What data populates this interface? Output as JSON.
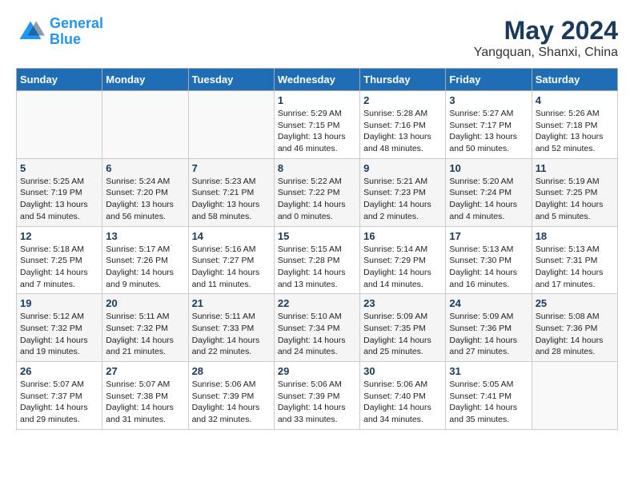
{
  "header": {
    "logo_line1": "General",
    "logo_line2": "Blue",
    "title": "May 2024",
    "subtitle": "Yangquan, Shanxi, China"
  },
  "weekdays": [
    "Sunday",
    "Monday",
    "Tuesday",
    "Wednesday",
    "Thursday",
    "Friday",
    "Saturday"
  ],
  "weeks": [
    [
      {
        "day": "",
        "sunrise": "",
        "sunset": "",
        "daylight": ""
      },
      {
        "day": "",
        "sunrise": "",
        "sunset": "",
        "daylight": ""
      },
      {
        "day": "",
        "sunrise": "",
        "sunset": "",
        "daylight": ""
      },
      {
        "day": "1",
        "sunrise": "Sunrise: 5:29 AM",
        "sunset": "Sunset: 7:15 PM",
        "daylight": "Daylight: 13 hours and 46 minutes."
      },
      {
        "day": "2",
        "sunrise": "Sunrise: 5:28 AM",
        "sunset": "Sunset: 7:16 PM",
        "daylight": "Daylight: 13 hours and 48 minutes."
      },
      {
        "day": "3",
        "sunrise": "Sunrise: 5:27 AM",
        "sunset": "Sunset: 7:17 PM",
        "daylight": "Daylight: 13 hours and 50 minutes."
      },
      {
        "day": "4",
        "sunrise": "Sunrise: 5:26 AM",
        "sunset": "Sunset: 7:18 PM",
        "daylight": "Daylight: 13 hours and 52 minutes."
      }
    ],
    [
      {
        "day": "5",
        "sunrise": "Sunrise: 5:25 AM",
        "sunset": "Sunset: 7:19 PM",
        "daylight": "Daylight: 13 hours and 54 minutes."
      },
      {
        "day": "6",
        "sunrise": "Sunrise: 5:24 AM",
        "sunset": "Sunset: 7:20 PM",
        "daylight": "Daylight: 13 hours and 56 minutes."
      },
      {
        "day": "7",
        "sunrise": "Sunrise: 5:23 AM",
        "sunset": "Sunset: 7:21 PM",
        "daylight": "Daylight: 13 hours and 58 minutes."
      },
      {
        "day": "8",
        "sunrise": "Sunrise: 5:22 AM",
        "sunset": "Sunset: 7:22 PM",
        "daylight": "Daylight: 14 hours and 0 minutes."
      },
      {
        "day": "9",
        "sunrise": "Sunrise: 5:21 AM",
        "sunset": "Sunset: 7:23 PM",
        "daylight": "Daylight: 14 hours and 2 minutes."
      },
      {
        "day": "10",
        "sunrise": "Sunrise: 5:20 AM",
        "sunset": "Sunset: 7:24 PM",
        "daylight": "Daylight: 14 hours and 4 minutes."
      },
      {
        "day": "11",
        "sunrise": "Sunrise: 5:19 AM",
        "sunset": "Sunset: 7:25 PM",
        "daylight": "Daylight: 14 hours and 5 minutes."
      }
    ],
    [
      {
        "day": "12",
        "sunrise": "Sunrise: 5:18 AM",
        "sunset": "Sunset: 7:25 PM",
        "daylight": "Daylight: 14 hours and 7 minutes."
      },
      {
        "day": "13",
        "sunrise": "Sunrise: 5:17 AM",
        "sunset": "Sunset: 7:26 PM",
        "daylight": "Daylight: 14 hours and 9 minutes."
      },
      {
        "day": "14",
        "sunrise": "Sunrise: 5:16 AM",
        "sunset": "Sunset: 7:27 PM",
        "daylight": "Daylight: 14 hours and 11 minutes."
      },
      {
        "day": "15",
        "sunrise": "Sunrise: 5:15 AM",
        "sunset": "Sunset: 7:28 PM",
        "daylight": "Daylight: 14 hours and 13 minutes."
      },
      {
        "day": "16",
        "sunrise": "Sunrise: 5:14 AM",
        "sunset": "Sunset: 7:29 PM",
        "daylight": "Daylight: 14 hours and 14 minutes."
      },
      {
        "day": "17",
        "sunrise": "Sunrise: 5:13 AM",
        "sunset": "Sunset: 7:30 PM",
        "daylight": "Daylight: 14 hours and 16 minutes."
      },
      {
        "day": "18",
        "sunrise": "Sunrise: 5:13 AM",
        "sunset": "Sunset: 7:31 PM",
        "daylight": "Daylight: 14 hours and 17 minutes."
      }
    ],
    [
      {
        "day": "19",
        "sunrise": "Sunrise: 5:12 AM",
        "sunset": "Sunset: 7:32 PM",
        "daylight": "Daylight: 14 hours and 19 minutes."
      },
      {
        "day": "20",
        "sunrise": "Sunrise: 5:11 AM",
        "sunset": "Sunset: 7:32 PM",
        "daylight": "Daylight: 14 hours and 21 minutes."
      },
      {
        "day": "21",
        "sunrise": "Sunrise: 5:11 AM",
        "sunset": "Sunset: 7:33 PM",
        "daylight": "Daylight: 14 hours and 22 minutes."
      },
      {
        "day": "22",
        "sunrise": "Sunrise: 5:10 AM",
        "sunset": "Sunset: 7:34 PM",
        "daylight": "Daylight: 14 hours and 24 minutes."
      },
      {
        "day": "23",
        "sunrise": "Sunrise: 5:09 AM",
        "sunset": "Sunset: 7:35 PM",
        "daylight": "Daylight: 14 hours and 25 minutes."
      },
      {
        "day": "24",
        "sunrise": "Sunrise: 5:09 AM",
        "sunset": "Sunset: 7:36 PM",
        "daylight": "Daylight: 14 hours and 27 minutes."
      },
      {
        "day": "25",
        "sunrise": "Sunrise: 5:08 AM",
        "sunset": "Sunset: 7:36 PM",
        "daylight": "Daylight: 14 hours and 28 minutes."
      }
    ],
    [
      {
        "day": "26",
        "sunrise": "Sunrise: 5:07 AM",
        "sunset": "Sunset: 7:37 PM",
        "daylight": "Daylight: 14 hours and 29 minutes."
      },
      {
        "day": "27",
        "sunrise": "Sunrise: 5:07 AM",
        "sunset": "Sunset: 7:38 PM",
        "daylight": "Daylight: 14 hours and 31 minutes."
      },
      {
        "day": "28",
        "sunrise": "Sunrise: 5:06 AM",
        "sunset": "Sunset: 7:39 PM",
        "daylight": "Daylight: 14 hours and 32 minutes."
      },
      {
        "day": "29",
        "sunrise": "Sunrise: 5:06 AM",
        "sunset": "Sunset: 7:39 PM",
        "daylight": "Daylight: 14 hours and 33 minutes."
      },
      {
        "day": "30",
        "sunrise": "Sunrise: 5:06 AM",
        "sunset": "Sunset: 7:40 PM",
        "daylight": "Daylight: 14 hours and 34 minutes."
      },
      {
        "day": "31",
        "sunrise": "Sunrise: 5:05 AM",
        "sunset": "Sunset: 7:41 PM",
        "daylight": "Daylight: 14 hours and 35 minutes."
      },
      {
        "day": "",
        "sunrise": "",
        "sunset": "",
        "daylight": ""
      }
    ]
  ]
}
